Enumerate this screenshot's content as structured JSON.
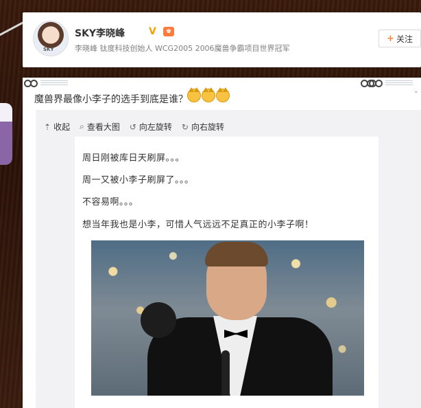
{
  "profile": {
    "name": "SKY李晓峰",
    "verified_symbol": "V",
    "level_symbol": "♚",
    "description": "李晓峰 钛度科技创始人 WCG2005 2006魔兽争霸项目世界冠军",
    "avatar_label": "SKY",
    "follow_label": "关注",
    "follow_icon": "plus-icon"
  },
  "post": {
    "title": "魔兽界最像小李子的选手到底是谁？",
    "emoji": [
      "cat-face-icon",
      "cat-face-icon",
      "cat-face-icon"
    ],
    "toolbar": {
      "collapse": "收起",
      "view_large": "查看大图",
      "rotate_left": "向左旋转",
      "rotate_right": "向右旋转"
    },
    "lines": [
      "周日刚被库日天刷屏。。。",
      "周一又被小李子刷屏了。。。",
      "不容易啊。。。",
      "想当年我也是小李，可惜人气远远不足真正的小李子啊！"
    ]
  },
  "colors": {
    "background": "#2b1208",
    "accent_orange": "#ff8140",
    "verified": "#f7a100"
  }
}
